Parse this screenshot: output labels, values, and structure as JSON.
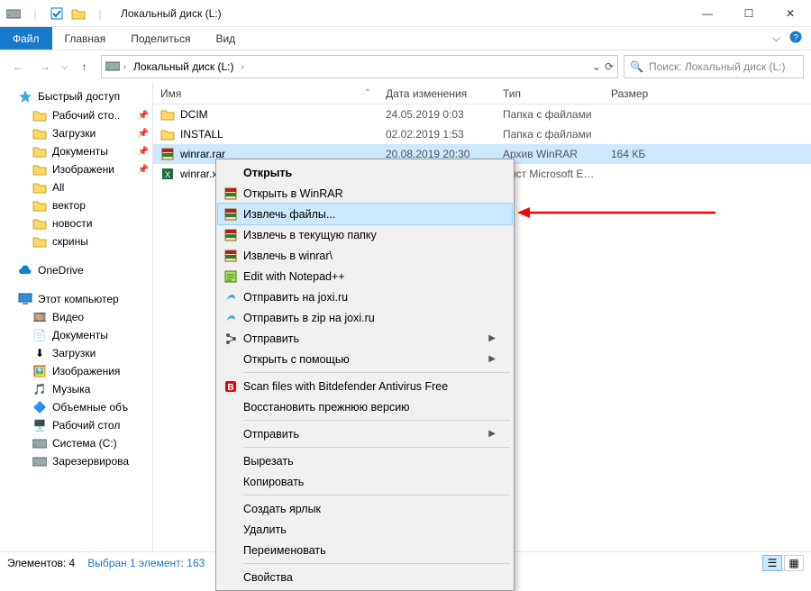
{
  "window": {
    "title": "Локальный диск (L:)"
  },
  "ribbon": {
    "file": "Файл",
    "tabs": [
      "Главная",
      "Поделиться",
      "Вид"
    ]
  },
  "breadcrumb": {
    "path": "Локальный диск (L:)"
  },
  "search": {
    "placeholder": "Поиск: Локальный диск (L:)"
  },
  "sidebar": {
    "quick_access": "Быстрый доступ",
    "quick_items": [
      {
        "label": "Рабочий сто..",
        "pinned": true
      },
      {
        "label": "Загрузки",
        "pinned": true
      },
      {
        "label": "Документы",
        "pinned": true
      },
      {
        "label": "Изображени",
        "pinned": true
      },
      {
        "label": "All",
        "pinned": false
      },
      {
        "label": "вектор",
        "pinned": false
      },
      {
        "label": "новости",
        "pinned": false
      },
      {
        "label": "скрины",
        "pinned": false
      }
    ],
    "onedrive": "OneDrive",
    "this_pc": "Этот компьютер",
    "pc_items": [
      "Видео",
      "Документы",
      "Загрузки",
      "Изображения",
      "Музыка",
      "Объемные объ",
      "Рабочий стол",
      "Система (C:)",
      "Зарезервирова"
    ]
  },
  "columns": {
    "name": "Имя",
    "date": "Дата изменения",
    "type": "Тип",
    "size": "Размер"
  },
  "files": [
    {
      "name": "DCIM",
      "date": "24.05.2019 0:03",
      "type": "Папка с файлами",
      "size": "",
      "kind": "folder"
    },
    {
      "name": "INSTALL",
      "date": "02.02.2019 1:53",
      "type": "Папка с файлами",
      "size": "",
      "kind": "folder"
    },
    {
      "name": "winrar.rar",
      "date": "20.08.2019 20:30",
      "type": "Архив WinRAR",
      "size": "164 КБ",
      "kind": "rar",
      "selected": true
    },
    {
      "name": "winrar.x",
      "date": "",
      "type": "Лист Microsoft Ex...",
      "size": "",
      "kind": "excel"
    }
  ],
  "context_menu": [
    {
      "label": "Открыть",
      "bold": true,
      "icon": ""
    },
    {
      "label": "Открыть в WinRAR",
      "icon": "rar"
    },
    {
      "label": "Извлечь файлы...",
      "icon": "rar",
      "highlight": true
    },
    {
      "label": "Извлечь в текущую папку",
      "icon": "rar"
    },
    {
      "label": "Извлечь в winrar\\",
      "icon": "rar"
    },
    {
      "label": "Edit with Notepad++",
      "icon": "npp"
    },
    {
      "label": "Отправить на joxi.ru",
      "icon": "joxi"
    },
    {
      "label": "Отправить в zip на joxi.ru",
      "icon": "joxi"
    },
    {
      "label": "Отправить",
      "icon": "send",
      "submenu": true
    },
    {
      "label": "Открыть с помощью",
      "submenu": true
    },
    {
      "sep": true
    },
    {
      "label": "Scan files with Bitdefender Antivirus Free",
      "icon": "bd"
    },
    {
      "label": "Восстановить прежнюю версию"
    },
    {
      "sep": true
    },
    {
      "label": "Отправить",
      "submenu": true
    },
    {
      "sep": true
    },
    {
      "label": "Вырезать"
    },
    {
      "label": "Копировать"
    },
    {
      "sep": true
    },
    {
      "label": "Создать ярлык"
    },
    {
      "label": "Удалить"
    },
    {
      "label": "Переименовать"
    },
    {
      "sep": true
    },
    {
      "label": "Свойства"
    }
  ],
  "status": {
    "count": "Элементов: 4",
    "selection": "Выбран 1 элемент: 163"
  }
}
